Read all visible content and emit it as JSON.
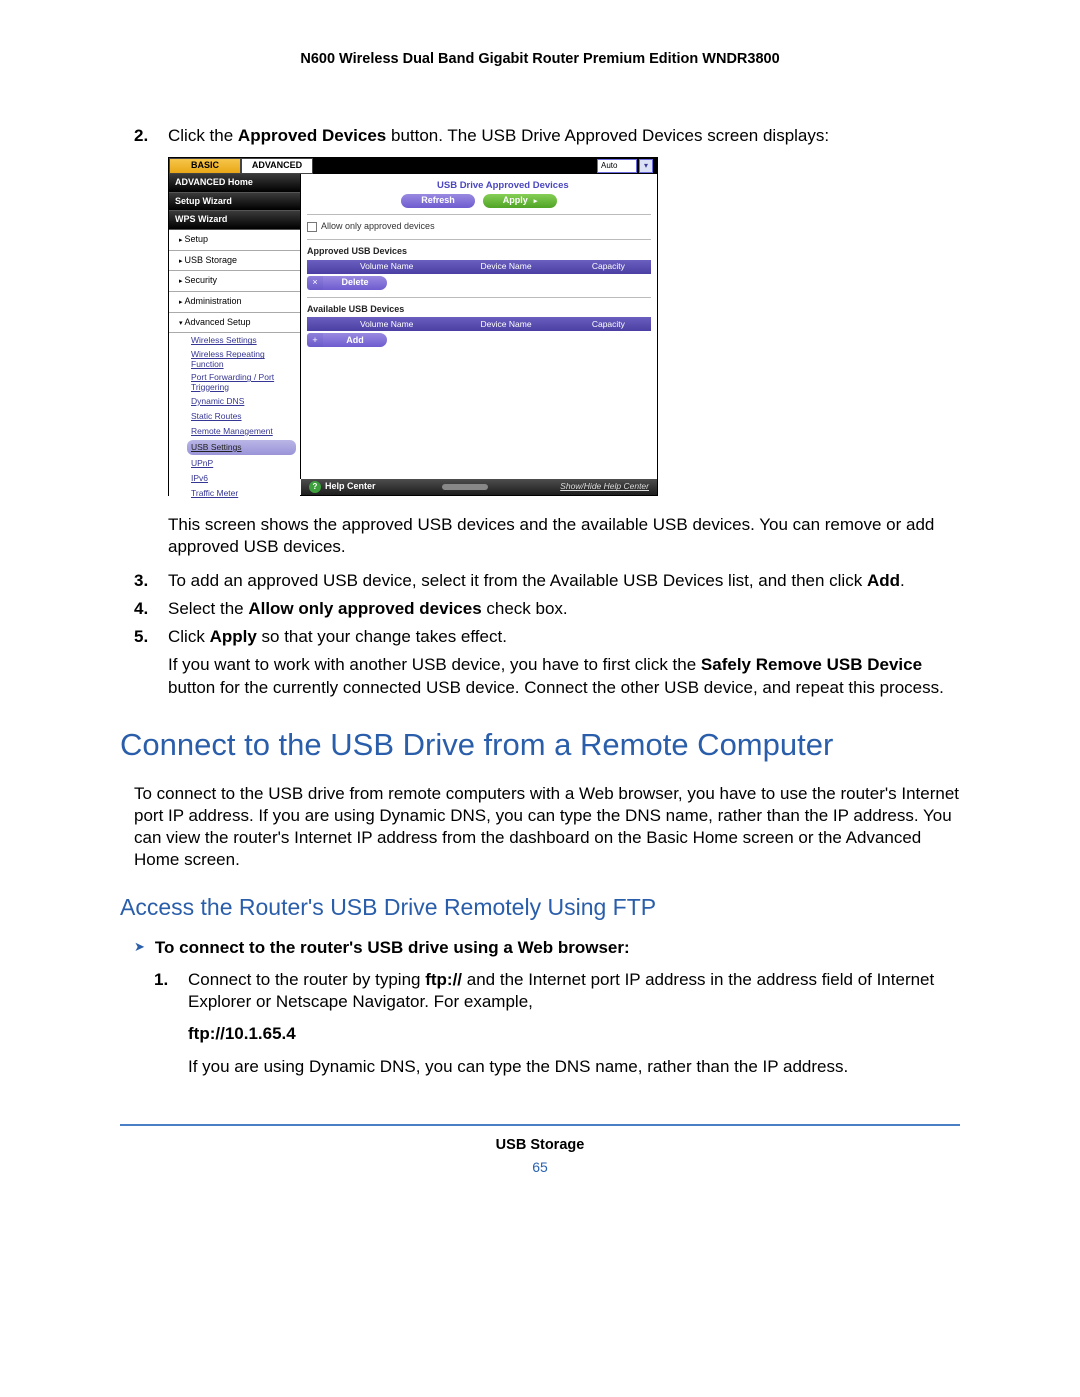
{
  "header": {
    "title": "N600 Wireless Dual Band Gigabit Router Premium Edition WNDR3800"
  },
  "steps": {
    "s2_pre": "Click the ",
    "s2_bold": "Approved Devices",
    "s2_post": " button. The USB Drive Approved Devices screen displays:",
    "s2_after": "This screen shows the approved USB devices and the available USB devices. You can remove or add approved USB devices.",
    "s3_pre": "To add an approved USB device, select it from the Available USB Devices list, and then click ",
    "s3_bold": "Add",
    "s3_post": ".",
    "s4_pre": "Select the ",
    "s4_bold": "Allow only approved devices",
    "s4_post": " check box.",
    "s5_pre": "Click ",
    "s5_bold": "Apply",
    "s5_post": " so that your change takes effect.",
    "tail_pre": "If you want to work with another USB device, you have to first click the ",
    "tail_bold": "Safely Remove USB Device",
    "tail_post": " button for the currently connected USB device. Connect the other USB device, and repeat this process."
  },
  "ui": {
    "tabs": {
      "basic": "BASIC",
      "advanced": "ADVANCED"
    },
    "auto_label": "Auto",
    "side": {
      "adv_home": "ADVANCED Home",
      "setup_wizard": "Setup Wizard",
      "wps_wizard": "WPS Wizard",
      "setup": "Setup",
      "usb_storage": "USB Storage",
      "security": "Security",
      "administration": "Administration",
      "advanced_setup": "Advanced Setup",
      "sub": {
        "wireless_settings": "Wireless Settings",
        "wireless_repeating": "Wireless Repeating Function",
        "port_fwd": "Port Forwarding / Port Triggering",
        "dynamic_dns": "Dynamic DNS",
        "static_routes": "Static Routes",
        "remote_mgmt": "Remote Management",
        "usb_settings": "USB Settings",
        "upnp": "UPnP",
        "ipv6": "IPv6",
        "traffic_meter": "Traffic Meter"
      }
    },
    "panel_title": "USB Drive Approved Devices",
    "btn_refresh": "Refresh",
    "btn_apply": "Apply",
    "chk_label": "Allow only approved devices",
    "sec_approved": "Approved USB Devices",
    "sec_available": "Available USB Devices",
    "cols": {
      "vol": "Volume Name",
      "dev": "Device Name",
      "cap": "Capacity"
    },
    "btn_delete": "Delete",
    "btn_add": "Add",
    "help_center": "Help Center",
    "help_toggle": "Show/Hide Help Center"
  },
  "h1": "Connect to the USB Drive from a Remote Computer",
  "p_remote": "To connect to the USB drive from remote computers with a Web browser, you have to use the router's Internet port IP address. If you are using Dynamic DNS, you can type the DNS name, rather than the IP address. You can view the router's Internet IP address from the dashboard on the Basic Home screen or the Advanced Home screen.",
  "h2": "Access the Router's USB Drive Remotely Using FTP",
  "proc_head": "To connect to the router's USB drive using a Web browser:",
  "ftp_step_pre": "Connect to the router by typing ",
  "ftp_step_bold": "ftp://",
  "ftp_step_post": " and the Internet port IP address in the address field of Internet Explorer or Netscape Navigator. For example,",
  "ftp_example": "ftp://10.1.65.4",
  "ftp_note": "If you are using Dynamic DNS, you can type the DNS name, rather than the IP address.",
  "footer": {
    "section": "USB Storage",
    "page": "65"
  }
}
